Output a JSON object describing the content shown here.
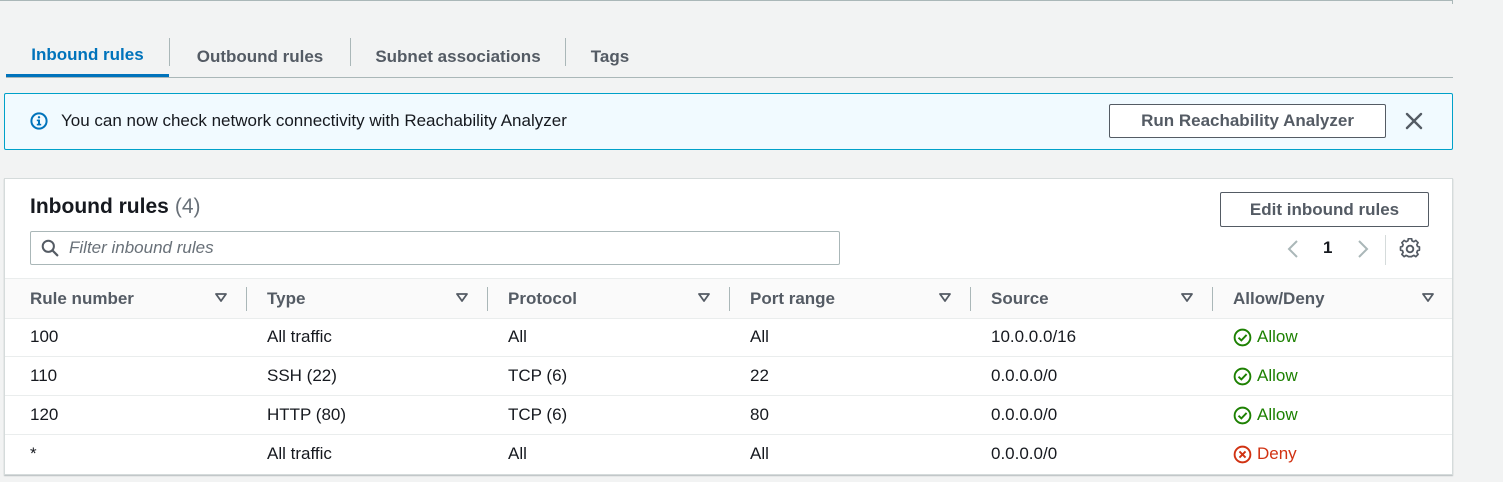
{
  "tabs": [
    {
      "label": "Inbound rules",
      "active": true
    },
    {
      "label": "Outbound rules",
      "active": false
    },
    {
      "label": "Subnet associations",
      "active": false
    },
    {
      "label": "Tags",
      "active": false
    }
  ],
  "banner": {
    "icon": "info-icon",
    "message": "You can now check network connectivity with Reachability Analyzer",
    "button_label": "Run Reachability Analyzer",
    "close_icon": "close-icon"
  },
  "panel": {
    "title": "Inbound rules",
    "count": "(4)",
    "edit_button": "Edit inbound rules",
    "filter_placeholder": "Filter inbound rules",
    "page": "1"
  },
  "table": {
    "columns": [
      "Rule number",
      "Type",
      "Protocol",
      "Port range",
      "Source",
      "Allow/Deny"
    ],
    "rows": [
      {
        "rule": "100",
        "type": "All traffic",
        "protocol": "All",
        "port": "All",
        "source": "10.0.0.0/16",
        "action": "Allow",
        "kind": "allow"
      },
      {
        "rule": "110",
        "type": "SSH (22)",
        "protocol": "TCP (6)",
        "port": "22",
        "source": "0.0.0.0/0",
        "action": "Allow",
        "kind": "allow"
      },
      {
        "rule": "120",
        "type": "HTTP (80)",
        "protocol": "TCP (6)",
        "port": "80",
        "source": "0.0.0.0/0",
        "action": "Allow",
        "kind": "allow"
      },
      {
        "rule": "*",
        "type": "All traffic",
        "protocol": "All",
        "port": "All",
        "source": "0.0.0.0/0",
        "action": "Deny",
        "kind": "deny"
      }
    ]
  },
  "colors": {
    "accent": "#0073bb",
    "allow": "#1d8102",
    "deny": "#d13212",
    "banner_border": "#00a1c9"
  }
}
